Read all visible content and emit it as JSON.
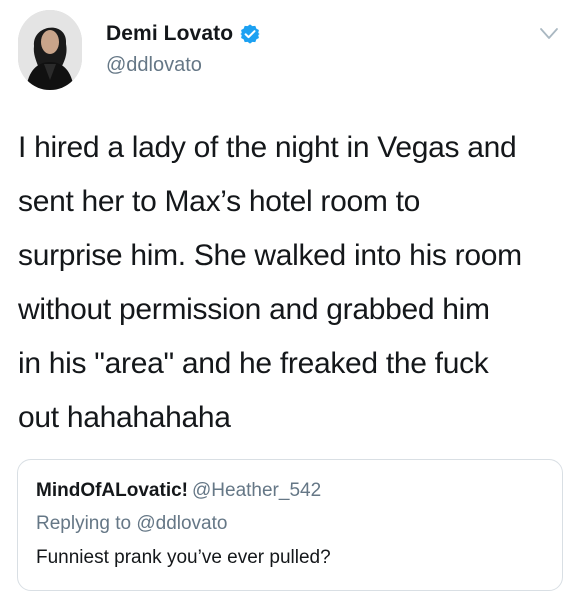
{
  "author": {
    "display_name": "Demi Lovato",
    "handle": "@ddlovato",
    "verified": true,
    "verified_icon": "verified-badge-icon",
    "accent_color": "#1da1f2"
  },
  "tweet": {
    "text": "I hired a lady of the night in Vegas and\nsent her to Max’s hotel room to\nsurprise him. She walked into his room\nwithout permission and grabbed him\nin his \"area\" and he freaked the fuck\nout hahahahaha"
  },
  "quoted": {
    "display_name": "MindOfALovatic!",
    "handle": "@Heather_542",
    "replying_prefix": "Replying to",
    "replying_handle": "@ddlovato",
    "text": "Funniest prank you’ve ever pulled?"
  },
  "icons": {
    "menu_caret": "chevron-down-icon"
  },
  "colors": {
    "text_primary": "#14171a",
    "text_secondary": "#657786",
    "border": "#d9dfe4"
  }
}
